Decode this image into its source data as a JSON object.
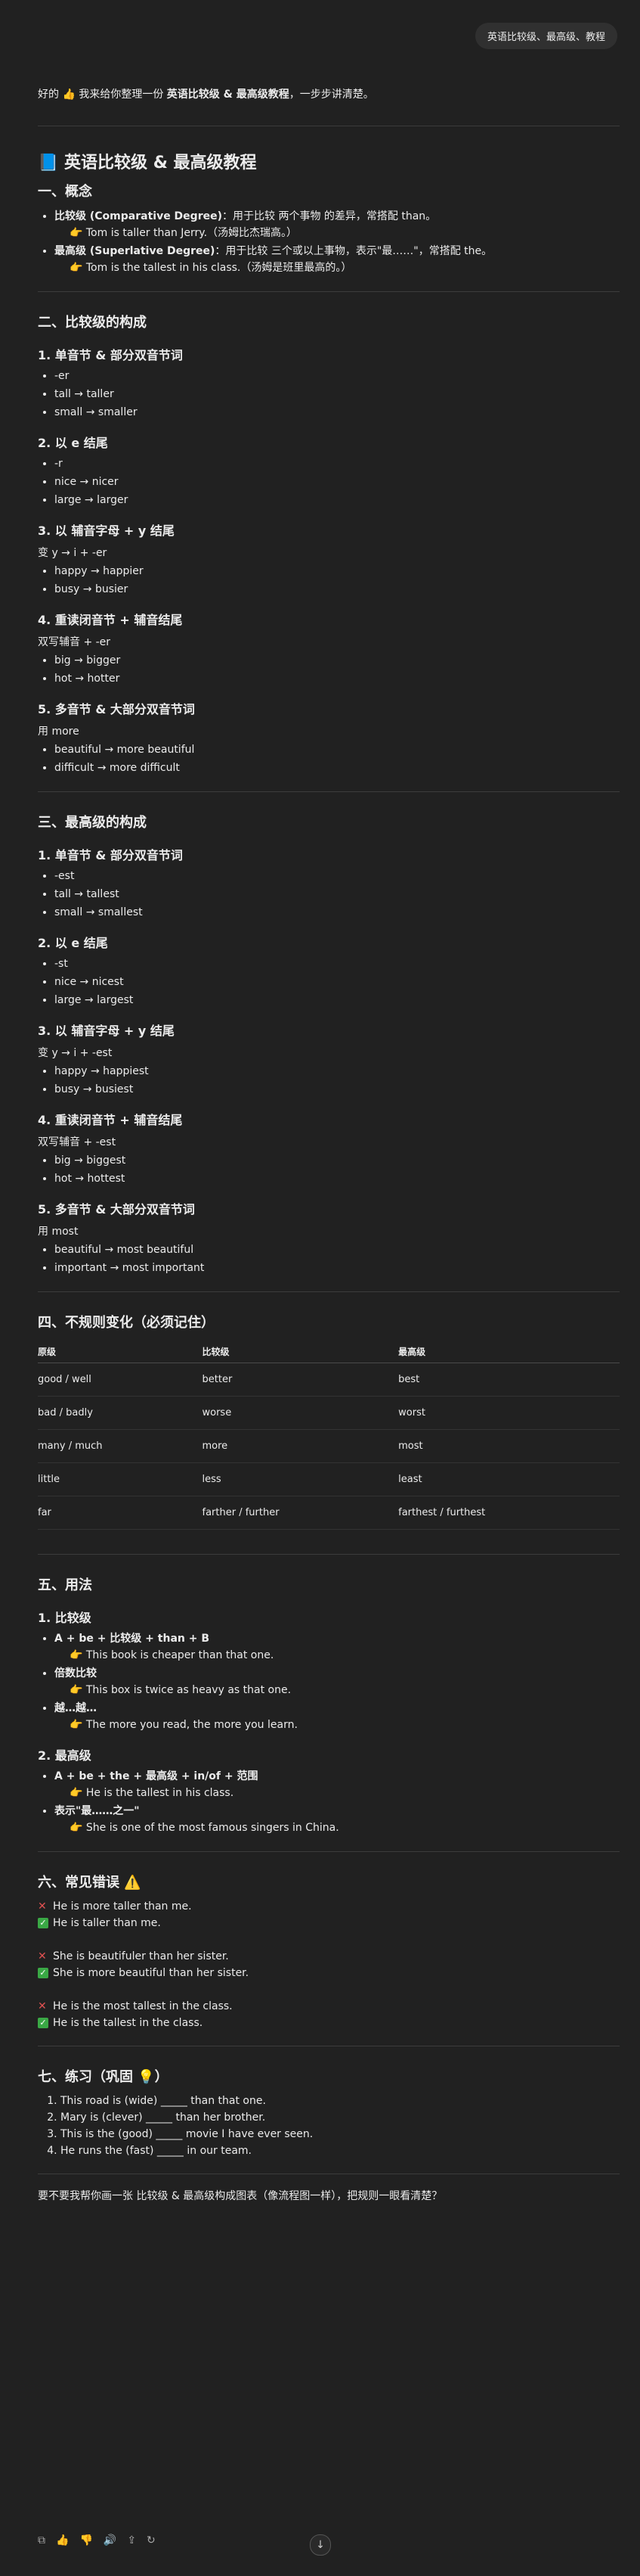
{
  "user_msg": "英语比较级、最高级、教程",
  "intro": {
    "prefix": "好的 👍 我来给你整理一份 ",
    "bold": "英语比较级 & 最高级教程",
    "suffix": "，一步步讲清楚。"
  },
  "title": "📘 英语比较级 & 最高级教程",
  "s1": {
    "heading": "一、概念",
    "items": [
      {
        "name": "比较级 (Comparative Degree)",
        "desc": "：用于比较 两个事物 的差异，常搭配 than。",
        "ex": "👉 Tom is taller than Jerry.（汤姆比杰瑞高。）"
      },
      {
        "name": "最高级 (Superlative Degree)",
        "desc": "：用于比较 三个或以上事物，表示\"最……\"，常搭配 the。",
        "ex": "👉 Tom is the tallest in his class.（汤姆是班里最高的。）"
      }
    ]
  },
  "s2": {
    "heading": "二、比较级的构成",
    "subs": [
      {
        "h": "1. 单音节 & 部分双音节词",
        "note": "",
        "items": [
          "-er",
          "tall → taller",
          "small → smaller"
        ]
      },
      {
        "h": "2. 以 e 结尾",
        "note": "",
        "items": [
          "-r",
          "nice → nicer",
          "large → larger"
        ]
      },
      {
        "h": "3. 以 辅音字母 + y 结尾",
        "note": "变 y → i + -er",
        "items": [
          "happy → happier",
          "busy → busier"
        ]
      },
      {
        "h": "4. 重读闭音节 + 辅音结尾",
        "note": "双写辅音 + -er",
        "items": [
          "big → bigger",
          "hot → hotter"
        ]
      },
      {
        "h": "5. 多音节 & 大部分双音节词",
        "note": "用 more",
        "items": [
          "beautiful → more beautiful",
          "difficult → more difficult"
        ]
      }
    ]
  },
  "s3": {
    "heading": "三、最高级的构成",
    "subs": [
      {
        "h": "1. 单音节 & 部分双音节词",
        "note": "",
        "items": [
          "-est",
          "tall → tallest",
          "small → smallest"
        ]
      },
      {
        "h": "2. 以 e 结尾",
        "note": "",
        "items": [
          "-st",
          "nice → nicest",
          "large → largest"
        ]
      },
      {
        "h": "3. 以 辅音字母 + y 结尾",
        "note": "变 y → i + -est",
        "items": [
          "happy → happiest",
          "busy → busiest"
        ]
      },
      {
        "h": "4. 重读闭音节 + 辅音结尾",
        "note": "双写辅音 + -est",
        "items": [
          "big → biggest",
          "hot → hottest"
        ]
      },
      {
        "h": "5. 多音节 & 大部分双音节词",
        "note": "用 most",
        "items": [
          "beautiful → most beautiful",
          "important → most important"
        ]
      }
    ]
  },
  "s4": {
    "heading": "四、不规则变化（必须记住）",
    "cols": [
      "原级",
      "比较级",
      "最高级"
    ],
    "rows": [
      [
        "good / well",
        "better",
        "best"
      ],
      [
        "bad / badly",
        "worse",
        "worst"
      ],
      [
        "many / much",
        "more",
        "most"
      ],
      [
        "little",
        "less",
        "least"
      ],
      [
        "far",
        "farther / further",
        "farthest / furthest"
      ]
    ]
  },
  "s5": {
    "heading": "五、用法",
    "sub1": "1. 比较级",
    "c": [
      {
        "text": "A + be + 比较级 + than + B",
        "ex": "👉 This book is cheaper than that one."
      },
      {
        "text": "倍数比较",
        "ex": "👉 This box is twice as heavy as that one."
      },
      {
        "text": "越…越…",
        "ex": "👉 The more you read, the more you learn."
      }
    ],
    "sub2": "2. 最高级",
    "s": [
      {
        "text": "A + be + the + 最高级 + in/of + 范围",
        "ex": "👉 He is the tallest in his class."
      },
      {
        "text": "表示\"最……之一\"",
        "ex": "👉 She is one of the most famous singers in China."
      }
    ]
  },
  "s6": {
    "heading": "六、常见错误 ⚠️",
    "groups": [
      {
        "wrong": "He is more taller than me.",
        "right": "He is taller than me."
      },
      {
        "wrong": "She is beautifuler than her sister.",
        "right": "She is more beautiful than her sister."
      },
      {
        "wrong": "He is the most tallest in the class.",
        "right": "He is the tallest in the class."
      }
    ]
  },
  "s7": {
    "heading": "七、练习（巩固 💡）",
    "items": [
      "This road is (wide) _____ than that one.",
      "Mary is (clever) _____ than her brother.",
      "This is the (good) _____ movie I have ever seen.",
      "He runs the (fast) _____ in our team."
    ]
  },
  "outro": "要不要我帮你画一张 比较级 & 最高级构成图表（像流程图一样），把规则一眼看清楚？",
  "toolbar": {
    "copy": "⧉",
    "like": "👍",
    "dislike": "👎",
    "read": "🔊",
    "share": "⇪",
    "regen": "↻",
    "scroll": "↓"
  }
}
